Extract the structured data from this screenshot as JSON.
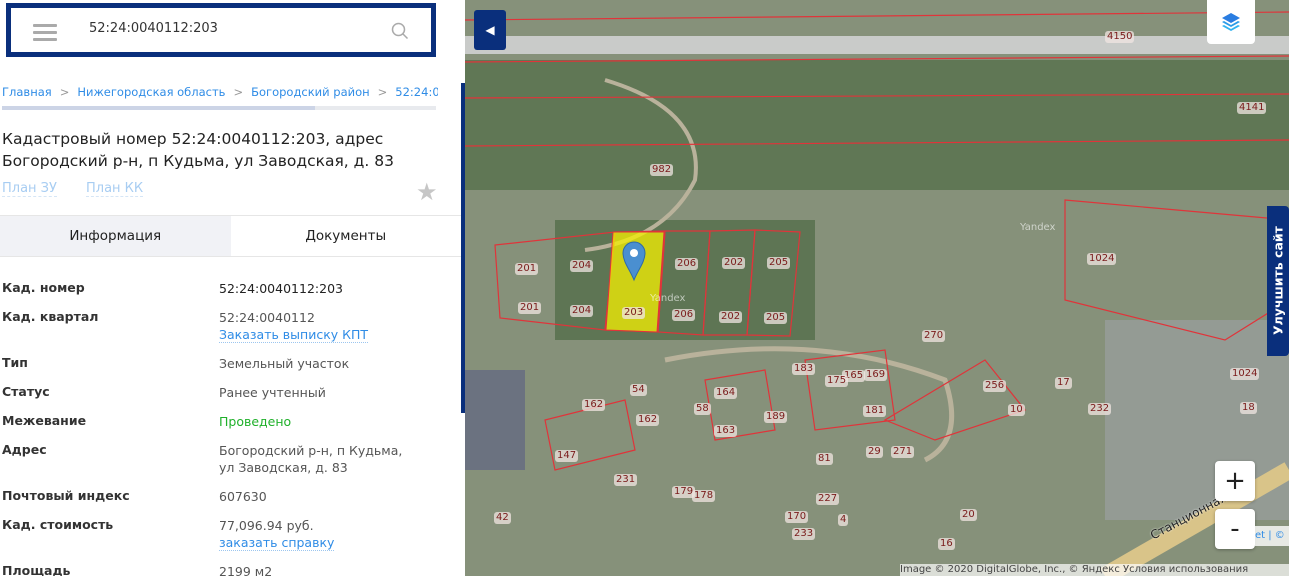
{
  "search": {
    "value": "52:24:0040112:203"
  },
  "breadcrumb": [
    "Главная",
    "Нижегородская область",
    "Богородский район",
    "52:24:0"
  ],
  "title": "Кадастровый номер 52:24:0040112:203, адрес Богородский р-н, п Кудьма, ул Заводская, д. 83",
  "plans": [
    "План ЗУ",
    "План КК"
  ],
  "tabs": [
    "Информация",
    "Документы"
  ],
  "rows": [
    {
      "k": "Кад. номер",
      "v": "52:24:0040112:203"
    },
    {
      "k": "Кад. квартал",
      "v": "52:24:0040112",
      "link": "Заказать выписку КПТ"
    },
    {
      "k": "Тип",
      "v": "Земельный участок"
    },
    {
      "k": "Статус",
      "v": "Ранее учтенный"
    },
    {
      "k": "Межевание",
      "v": "Проведено"
    },
    {
      "k": "Адрес",
      "v": "Богородский р-н, п Кудьма,",
      "v2": "ул Заводская, д. 83"
    },
    {
      "k": "Почтовый индекс",
      "v": "607630"
    },
    {
      "k": "Кад. стоимость",
      "v": "77,096.94 руб.",
      "link": "заказать справку"
    },
    {
      "k": "Площадь",
      "v": "2199 м2"
    }
  ],
  "map": {
    "labels": [
      "4150",
      "4141",
      "982",
      "201",
      "204",
      "206",
      "202",
      "205",
      "1024",
      "201",
      "204",
      "203",
      "206",
      "202",
      "205",
      "270",
      "183",
      "165",
      "169",
      "164",
      "162",
      "162",
      "189",
      "163",
      "256",
      "10",
      "17",
      "232",
      "1024",
      "18",
      "147",
      "231",
      "179",
      "178",
      "227",
      "170",
      "233",
      "271",
      "81",
      "20",
      "16",
      "42",
      "4",
      "175",
      "181",
      "54",
      "58",
      "29"
    ],
    "watermarks": [
      "Yandex",
      "Yandex"
    ],
    "street": "Станционная ул.",
    "attribution": "Image © 2020 DigitalGlobe, Inc., © Яндекс Условия использования",
    "attribution_link": "et | ©",
    "zoom_in": "+",
    "zoom_out": "-",
    "improve": "Улучшить сайт",
    "highlight_color": "#f5f000"
  }
}
